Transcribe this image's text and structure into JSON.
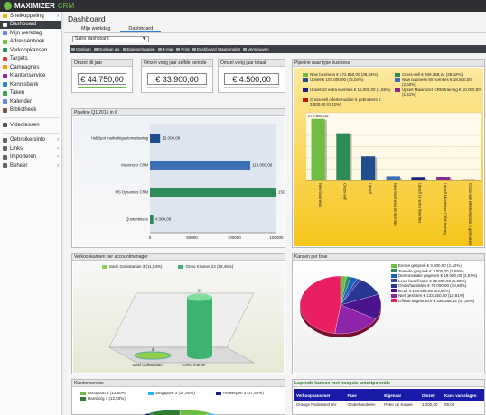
{
  "app": {
    "brand": "MAXIMIZER",
    "brand_suffix": "CRM"
  },
  "sidebar": {
    "items": [
      {
        "label": "Snelkoppeling",
        "icon": "star-icon",
        "chev": true
      },
      {
        "label": "Dashboard",
        "icon": "dashboard-icon",
        "active": true
      },
      {
        "label": "Mijn werkdag",
        "icon": "calendar-icon"
      },
      {
        "label": "Adressenboek",
        "icon": "book-icon"
      },
      {
        "label": "Verkoopkansen",
        "icon": "money-icon"
      },
      {
        "label": "Targets",
        "icon": "target-icon"
      },
      {
        "label": "Campagnes",
        "icon": "campaign-icon"
      },
      {
        "label": "Klantenservice",
        "icon": "support-icon"
      },
      {
        "label": "Kennisbank",
        "icon": "knowledge-icon"
      },
      {
        "label": "Taken",
        "icon": "tasks-icon"
      },
      {
        "label": "Kalender",
        "icon": "calendar-icon"
      },
      {
        "label": "Bibliotheek",
        "icon": "library-icon"
      },
      {
        "sep": true
      },
      {
        "label": "Videolessen",
        "icon": "video-icon"
      },
      {
        "sep": true
      },
      {
        "label": "Gebruikersinfo",
        "icon": "user-icon",
        "chev": true
      },
      {
        "label": "Links",
        "icon": "link-icon",
        "chev": true
      },
      {
        "label": "Importeren",
        "icon": "import-icon",
        "chev": true
      },
      {
        "label": "Beheer",
        "icon": "gear-icon",
        "chev": true
      }
    ]
  },
  "page": {
    "title": "Dashboard",
    "tabs": [
      "Mijn werkdag",
      "Dashboard"
    ],
    "selected_dashboard": "Sales dashboard"
  },
  "toolbar": [
    "Opslaan",
    "Opslaan als",
    "Eigenschappen",
    "E-mail",
    "Print",
    "Dashboard Stappenplan",
    "Vernieuwen"
  ],
  "kpis": [
    {
      "title": "Omzet dit jaar",
      "value": "€ 44.750,00",
      "bar_color": "#6fbe44"
    },
    {
      "title": "Omzet vorig jaar zelfde periode",
      "value": "€ 33.900,00",
      "bar_color": "#cccccc"
    },
    {
      "title": "Omzet vorig jaar totaal",
      "value": "€ 4.500,00",
      "bar_color": "#cccccc"
    }
  ],
  "pipeline_q1": {
    "title": "Pipeline Q1 2016 in €"
  },
  "per_type": {
    "title": "Pipeline naar type business"
  },
  "per_am": {
    "title": "Verkoopkansen per accountmanager"
  },
  "kansen_fase": {
    "title": "Kansen per fase"
  },
  "klanten": {
    "title": "Klantenservice"
  },
  "lopend": {
    "title": "Lopende kansen met hoogste omzetpotentie",
    "headers": [
      "Verkoopkans met",
      "Fase",
      "Eigenaar",
      "Omzet",
      "Kans van slagen"
    ],
    "rows": [
      [
        "Orange Nederland NV",
        "Onderhandelen",
        "Peter de Karper",
        "1.000,00",
        "09,00"
      ]
    ]
  },
  "chart_data": [
    {
      "type": "bar",
      "orientation": "horizontal",
      "categories": [
        "HubSpot marketingautomatisering",
        "Maximizer CRM",
        "MS Dynamics CRM",
        "Quotenteteks"
      ],
      "values": [
        12000,
        119000,
        150000,
        4000
      ],
      "data_labels": [
        "12.000,00",
        "119.000,00",
        "150.000,00",
        "4.000,00"
      ],
      "xlim": [
        0,
        150000
      ],
      "xticks": [
        "0",
        "50000",
        "100000",
        "150000"
      ]
    },
    {
      "type": "bar",
      "categories": [
        "New business",
        "Cross-sell",
        "Upsell",
        "New business 60 licenties",
        "Upsell 10 extra licenties",
        "Upsell Maximizer CRM training",
        "Cross-sell offertemodule 5 gebruikers"
      ],
      "values": [
        272850,
        209358,
        107000,
        18500,
        15000,
        16000,
        5000
      ],
      "data_labels": [
        "272.850,00",
        "",
        "",
        "",
        "",
        "",
        ""
      ],
      "legend": [
        "New business € 272.850,00 (38,34%)",
        "Cross-sell € 209.358,34 (29,42%)",
        "Upsell € 107.000,00 (15,04%)",
        "New business 60 licenties € 18.500,00 (2,60%)",
        "Upsell 10 extra licenties € 15.000,00 (1,55%)",
        "Upsell Maximizer CRM training € 10.000,00 (1,41%)",
        "Cross-sell offertemodule 5 gebruikers € 3.000,00 (0,42%)"
      ],
      "colors": [
        "#6fbe44",
        "#2e8b57",
        "#1e4f8c",
        "#3b6fb6",
        "#1a237e",
        "#8e2b8e",
        "#c21807"
      ]
    },
    {
      "type": "bar",
      "categories": [
        "Sami Golestanian",
        "Onno Kramer"
      ],
      "values": [
        3,
        23
      ],
      "data_labels": [
        "3",
        "23"
      ],
      "legend": [
        "Sami Golestanian 3 (11,54%)",
        "Onno Kramer 23 (88,46%)"
      ],
      "colors": [
        "#8fd14f",
        "#3cb371"
      ]
    },
    {
      "type": "pie",
      "labels": [
        "Eerste gesprek € 3.000,00 (2,42%)",
        "Tweede gesprek € 1.000,00 (1,55%)",
        "Demonstratie gegeven € 19.000,00 (2,67%)",
        "Lead kwalificatie € 32.000,00 (1,50%)",
        "Onderhandelen € 76.000,00 (10,68%)",
        "Deal! € 100.300,00 (14,09%)",
        "Niet gesloten € 133.650,00 (18,81%)",
        "Offerte uitgebracht € 336.358,34 (47,26%)"
      ],
      "values": [
        2.42,
        1.55,
        2.67,
        1.5,
        10.68,
        14.09,
        18.81,
        47.26
      ],
      "colors": [
        "#6fbe44",
        "#2e8b57",
        "#1565c0",
        "#3949ab",
        "#283593",
        "#4a148c",
        "#8e24aa",
        "#e91e63"
      ]
    },
    {
      "type": "pie",
      "labels": [
        "Europoort 1 (12,50%)",
        "Singapore 3 (37,50%)",
        "Antwerpen 3 (37,50%)",
        "Hamburg 1 (12,50%)"
      ],
      "values": [
        12.5,
        37.5,
        37.5,
        12.5
      ],
      "colors": [
        "#6fbe44",
        "#29b6f6",
        "#1a237e",
        "#2e7d32"
      ]
    }
  ]
}
